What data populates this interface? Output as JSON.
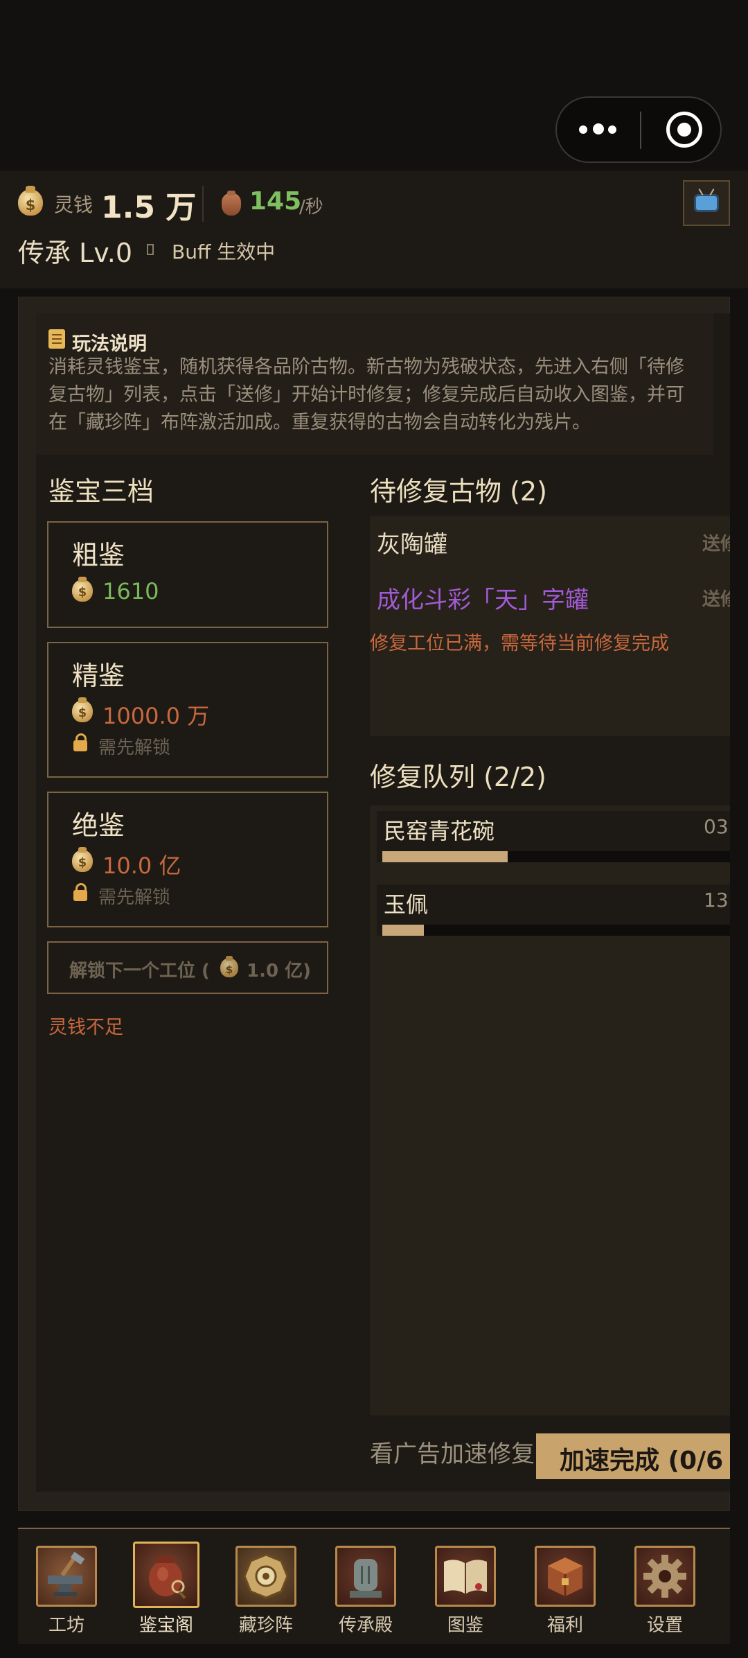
{
  "header": {
    "coin_label": "灵钱",
    "coin_value": "1.5 万",
    "rate_value": "145",
    "rate_unit": "/秒",
    "legacy_level": "传承 Lv.0",
    "buff_status": "Buff 生效中"
  },
  "help": {
    "title": "玩法说明",
    "text": "消耗灵钱鉴宝，随机获得各品阶古物。新古物为残破状态，先进入右侧「待修复古物」列表，点击「送修」开始计时修复；修复完成后自动收入图鉴，并可在「藏珍阵」布阵激活加成。重复获得的古物会自动转化为残片。"
  },
  "appraisal": {
    "title": "鉴宝三档",
    "tiers": [
      {
        "name": "粗鉴",
        "price": "1610",
        "price_color": "#7ab85a",
        "locked": false
      },
      {
        "name": "精鉴",
        "price": "1000.0 万",
        "price_color": "#c9683e",
        "locked": true,
        "lock_text": "需先解锁"
      },
      {
        "name": "绝鉴",
        "price": "10.0 亿",
        "price_color": "#c9683e",
        "locked": true,
        "lock_text": "需先解锁"
      }
    ],
    "unlock_label": "解锁下一个工位 (",
    "unlock_price": "1.0 亿)",
    "not_enough": "灵钱不足"
  },
  "pending": {
    "title": "待修复古物 (2)",
    "items": [
      {
        "name": "灰陶罐",
        "color": "#e9dcc2",
        "send_label": "送修"
      },
      {
        "name": "成化斗彩「天」字罐",
        "color": "#a35ad6",
        "send_label": "送修"
      }
    ],
    "warning": "修复工位已满，需等待当前修复完成"
  },
  "queue": {
    "title": "修复队列 (2/2)",
    "items": [
      {
        "name": "民窑青花碗",
        "time": "03",
        "progress": 0.36
      },
      {
        "name": "玉佩",
        "time": "13",
        "progress": 0.12
      }
    ],
    "ad_hint": "看广告加速修复",
    "speedup_label": "加速完成 (0/6"
  },
  "nav": {
    "items": [
      {
        "label": "工坊",
        "icon": "anvil-icon",
        "active": false
      },
      {
        "label": "鉴宝阁",
        "icon": "vase-icon",
        "active": true
      },
      {
        "label": "藏珍阵",
        "icon": "bagua-icon",
        "active": false
      },
      {
        "label": "传承殿",
        "icon": "stele-icon",
        "active": false
      },
      {
        "label": "图鉴",
        "icon": "book-icon",
        "active": false
      },
      {
        "label": "福利",
        "icon": "chest-icon",
        "active": false
      },
      {
        "label": "设置",
        "icon": "gear-icon",
        "active": false
      }
    ]
  }
}
